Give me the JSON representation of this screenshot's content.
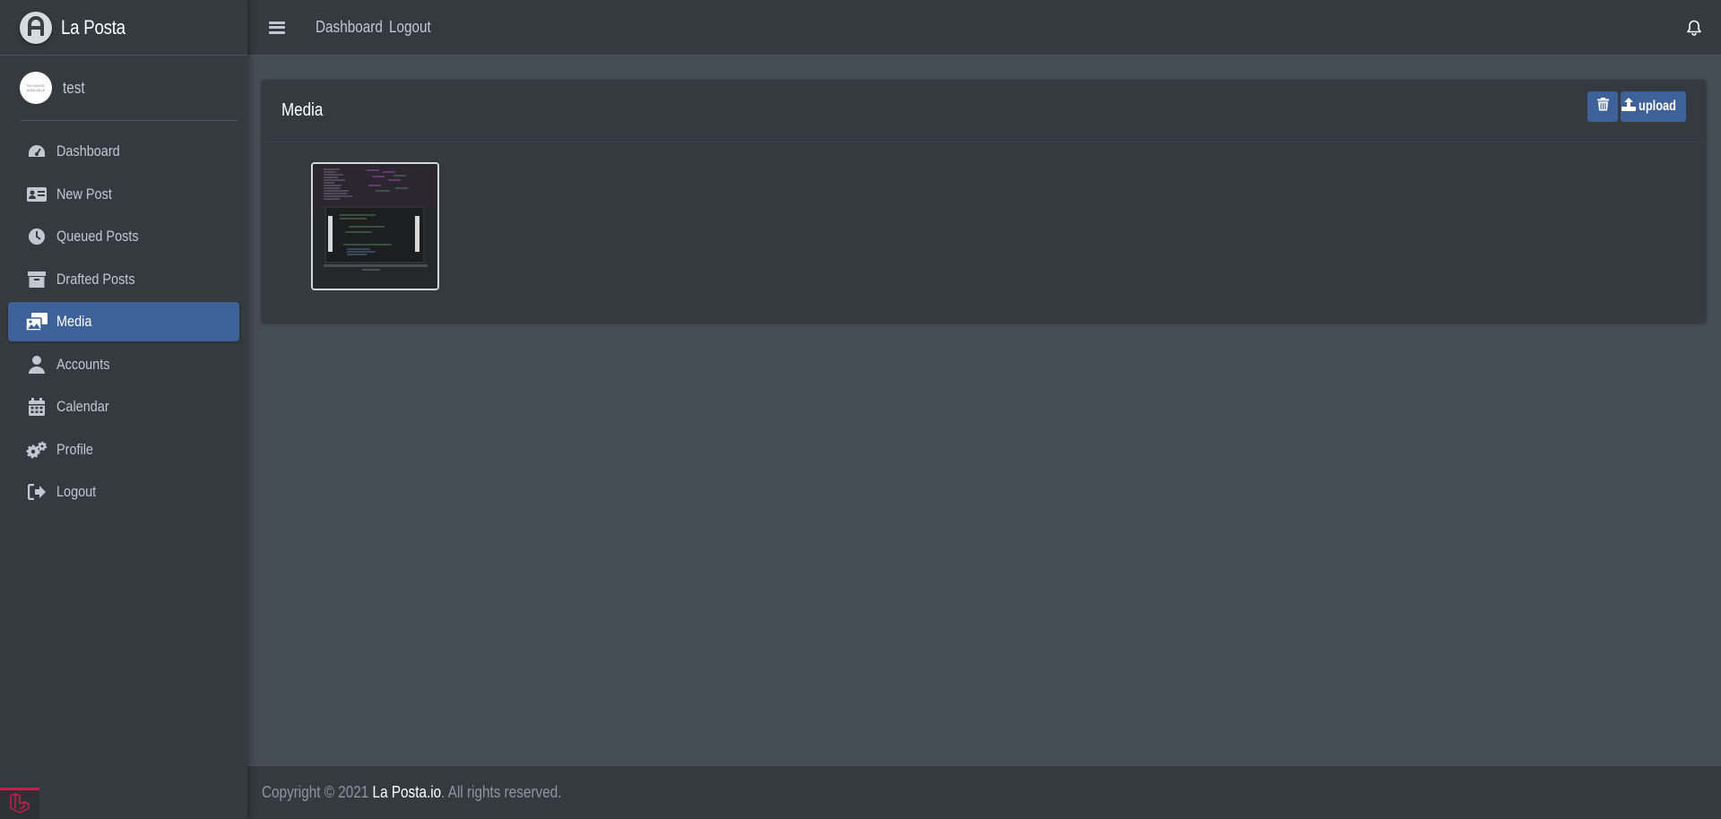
{
  "brand": {
    "name": "La Posta"
  },
  "user": {
    "name": "test",
    "avatar_text": "NO IMAGE AVAILABLE"
  },
  "sidebar": {
    "items": [
      {
        "label": "Dashboard",
        "icon": "tachometer-icon"
      },
      {
        "label": "New Post",
        "icon": "id-card-icon"
      },
      {
        "label": "Queued Posts",
        "icon": "clock-icon"
      },
      {
        "label": "Drafted Posts",
        "icon": "archive-icon"
      },
      {
        "label": "Media",
        "icon": "photo-video-icon",
        "active": true
      },
      {
        "label": "Accounts",
        "icon": "user-icon"
      },
      {
        "label": "Calendar",
        "icon": "calendar-icon"
      },
      {
        "label": "Profile",
        "icon": "cogs-icon"
      },
      {
        "label": "Logout",
        "icon": "sign-out-icon"
      }
    ]
  },
  "topbar": {
    "links": [
      "Dashboard",
      "Logout"
    ]
  },
  "card": {
    "title": "Media",
    "upload_label": "upload"
  },
  "footer": {
    "prefix": "Copyright © 2021 ",
    "brand": "La Posta.io",
    "suffix": ". All rights reserved."
  },
  "colors": {
    "sidebar_bg": "#343a40",
    "content_bg": "#454d55",
    "accent": "#3f6199",
    "laravel_red": "#c91d4a"
  }
}
